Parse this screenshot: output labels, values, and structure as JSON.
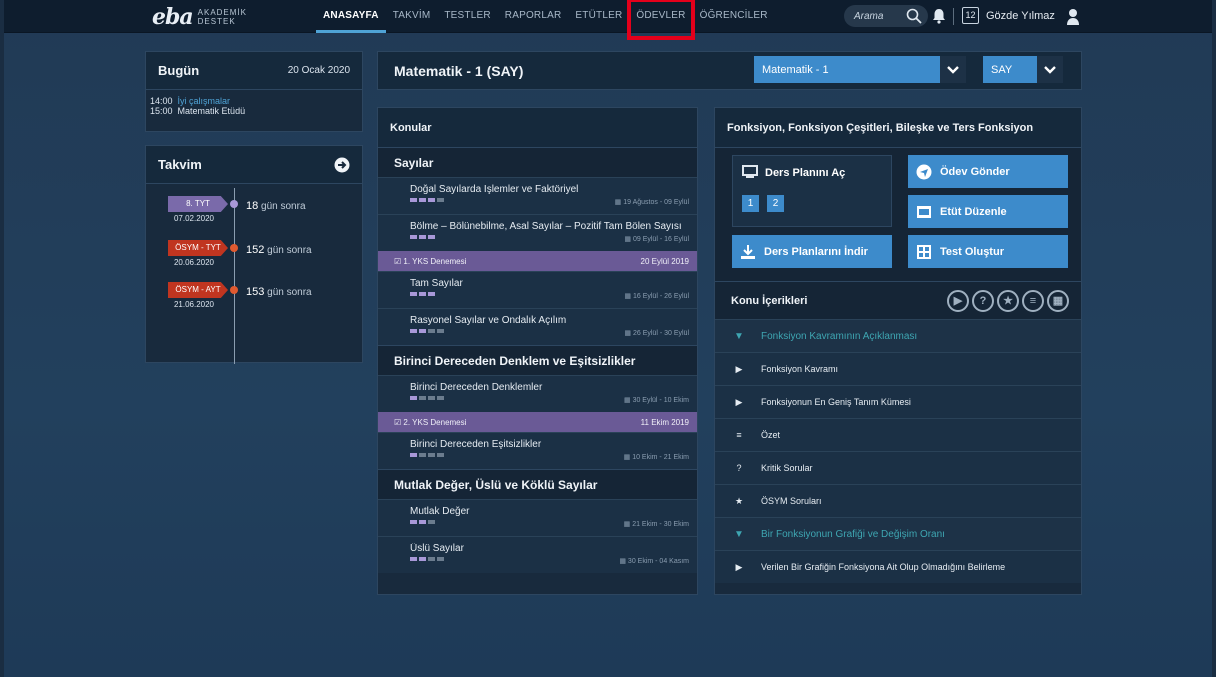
{
  "brand": {
    "logo": "eba",
    "sub1": "AKADEMİK",
    "sub2": "DESTEK"
  },
  "nav": [
    "ANASAYFA",
    "TAKVİM",
    "TESTLER",
    "RAPORLAR",
    "ETÜTLER",
    "ÖDEVLER",
    "ÖĞRENCİLER"
  ],
  "search": {
    "label": "Arama"
  },
  "calendar_badge": "12",
  "user": "Gözde Yılmaz",
  "today": {
    "title": "Bugün",
    "date": "20 Ocak 2020",
    "events": [
      {
        "time": "14:00",
        "text": "İyi çalışmalar"
      },
      {
        "time": "15:00",
        "text": "Matematik Etüdü"
      }
    ]
  },
  "takvim": {
    "title": "Takvim",
    "exams": [
      {
        "tag": "8. TYT",
        "date": "07.02.2020",
        "days": "18",
        "suffix": "gün sonra",
        "color": "#7a6aaa"
      },
      {
        "tag": "ÖSYM - TYT",
        "date": "20.06.2020",
        "days": "152",
        "suffix": "gün sonra",
        "color": "#c03520"
      },
      {
        "tag": "ÖSYM - AYT",
        "date": "21.06.2020",
        "days": "153",
        "suffix": "gün sonra",
        "color": "#c03520"
      }
    ]
  },
  "subject": {
    "title": "Matematik - 1 (SAY)",
    "select": "Matematik - 1",
    "group": "SAY"
  },
  "konular": {
    "title": "Konular",
    "sec1": "Sayılar",
    "t1": {
      "name": "Doğal Sayılarda İşlemler ve Faktöriyel",
      "range": "19 Ağustos - 09 Eylül"
    },
    "t2": {
      "name": "Bölme – Bölünebilme, Asal Sayılar – Pozitif Tam Bölen Sayısı",
      "range": "09 Eylül - 16 Eylül"
    },
    "d1": {
      "label": "1. YKS Denemesi",
      "date": "20 Eylül 2019"
    },
    "t3": {
      "name": "Tam Sayılar",
      "range": "16 Eylül - 26 Eylül"
    },
    "t4": {
      "name": "Rasyonel Sayılar ve Ondalık Açılım",
      "range": "26 Eylül - 30 Eylül"
    },
    "sec2": "Birinci Dereceden Denklem ve Eşitsizlikler",
    "t5": {
      "name": "Birinci Dereceden Denklemler",
      "range": "30 Eylül - 10 Ekim"
    },
    "d2": {
      "label": "2. YKS Denemesi",
      "date": "11 Ekim 2019"
    },
    "t6": {
      "name": "Birinci Dereceden Eşitsizlikler",
      "range": "10 Ekim - 21 Ekim"
    },
    "sec3": "Mutlak Değer, Üslü ve Köklü Sayılar",
    "t7": {
      "name": "Mutlak Değer",
      "range": "21 Ekim - 30 Ekim"
    },
    "t8": {
      "name": "Üslü Sayılar",
      "range": "30 Ekim - 04 Kasım"
    }
  },
  "konu": {
    "title": "Fonksiyon, Fonksiyon Çeşitleri, Bileşke ve Ters Fonksiyon",
    "ders_plani": "Ders Planını Aç",
    "plan1": "1",
    "plan2": "2",
    "indir": "Ders Planlarını İndir",
    "odev": "Ödev Gönder",
    "etut": "Etüt Düzenle",
    "test": "Test Oluştur",
    "icerik_title": "Konu İçerikleri",
    "rows": [
      {
        "text": "Fonksiyon Kavramının Açıklanması"
      },
      {
        "text": "Fonksiyon Kavramı"
      },
      {
        "text": "Fonksiyonun En Geniş Tanım Kümesi"
      },
      {
        "text": "Özet"
      },
      {
        "text": "Kritik Sorular"
      },
      {
        "text": "ÖSYM Soruları"
      },
      {
        "text": "Bir Fonksiyonun Grafiği ve Değişim Oranı"
      },
      {
        "text": "Verilen Bir Grafiğin Fonksiyona Ait Olup Olmadığını Belirleme"
      }
    ]
  },
  "colors": {
    "accent": "#3d8bcb",
    "deneme": "#6a5a96",
    "highlight": "#e4001b",
    "teal": "#3ea6b2"
  }
}
